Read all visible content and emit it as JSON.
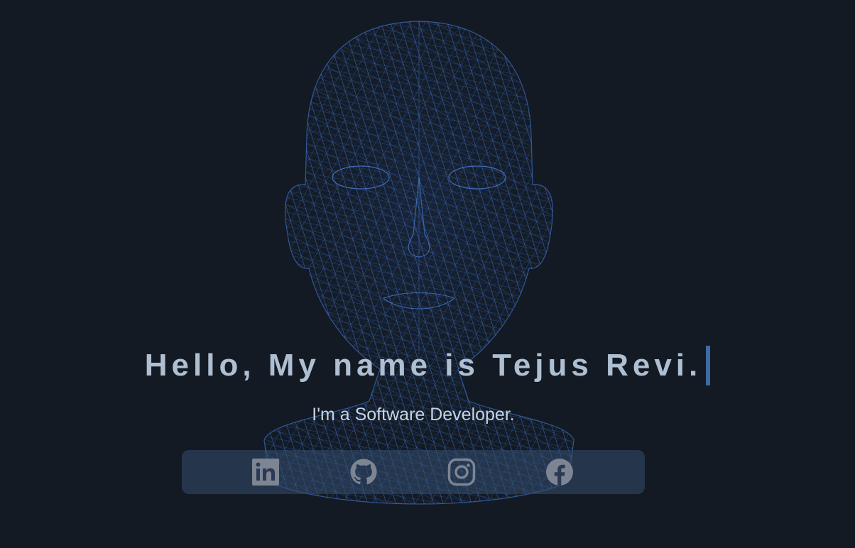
{
  "hero": {
    "title": "Hello, My name is Tejus Revi.",
    "subtitle": "I'm a Software Developer."
  },
  "social": {
    "links": [
      {
        "icon": "linkedin-icon"
      },
      {
        "icon": "github-icon"
      },
      {
        "icon": "instagram-icon"
      },
      {
        "icon": "facebook-icon"
      }
    ]
  },
  "colors": {
    "background": "#131a23",
    "mesh": "#3e6fc4",
    "title": "#aebfd2",
    "caret": "#3f6aa3",
    "icon": "#7d8593"
  }
}
